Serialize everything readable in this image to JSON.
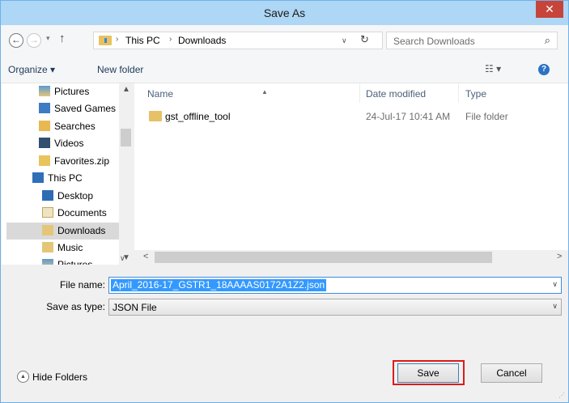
{
  "window": {
    "title": "Save As",
    "close_glyph": "✕",
    "accent_color": "#aed6f5",
    "close_color": "#c7443a"
  },
  "nav": {
    "back_glyph": "←",
    "forward_glyph": "→",
    "recent_glyph": "▾",
    "up_glyph": "↑",
    "breadcrumb": [
      "This PC",
      "Downloads"
    ],
    "breadcrumb_separator": "›",
    "address_dropdown_glyph": "∨",
    "refresh_glyph": "↻",
    "search_placeholder": "Search Downloads",
    "search_glyph": "⌕"
  },
  "toolbar": {
    "organize_label": "Organize ▾",
    "new_folder_label": "New folder",
    "view_glyph": "☷ ▾",
    "help_glyph": "?"
  },
  "tree": {
    "items": [
      {
        "label": "Pictures",
        "icon": "pictures-folder-icon",
        "selected": false
      },
      {
        "label": "Saved Games",
        "icon": "saved-games-icon",
        "selected": false
      },
      {
        "label": "Searches",
        "icon": "searches-icon",
        "selected": false
      },
      {
        "label": "Videos",
        "icon": "videos-icon",
        "selected": false
      },
      {
        "label": "Favorites.zip",
        "icon": "zip-icon",
        "selected": false
      },
      {
        "label": "This PC",
        "icon": "computer-icon",
        "selected": false
      },
      {
        "label": "Desktop",
        "icon": "desktop-icon",
        "selected": false
      },
      {
        "label": "Documents",
        "icon": "documents-icon",
        "selected": false
      },
      {
        "label": "Downloads",
        "icon": "downloads-icon",
        "selected": true
      },
      {
        "label": "Music",
        "icon": "music-icon",
        "selected": false
      },
      {
        "label": "Pictures",
        "icon": "pictures-folder-icon",
        "selected": false
      }
    ],
    "scroll_up_glyph": "▲",
    "scroll_down_glyph": "▼",
    "collapse_glyph": "∨"
  },
  "files": {
    "columns": {
      "name": "Name",
      "date_modified": "Date modified",
      "type": "Type",
      "sort_glyph": "▲"
    },
    "rows": [
      {
        "name": "gst_offline_tool",
        "date_modified": "24-Jul-17 10:41 AM",
        "type": "File folder",
        "icon": "folder-icon"
      }
    ],
    "hscroll_left_glyph": "<",
    "hscroll_right_glyph": ">"
  },
  "form": {
    "file_name_label": "File name:",
    "file_name_value": "April_2016-17_GSTR1_18AAAAS0172A1Z2.json",
    "save_as_type_label": "Save as type:",
    "save_as_type_value": "JSON File",
    "dropdown_glyph": "∨"
  },
  "footer": {
    "hide_folders_label": "Hide Folders",
    "hide_folders_glyph": "▲",
    "save_label": "Save",
    "cancel_label": "Cancel",
    "highlight_color": "#e01919",
    "grip_glyph": "⋰"
  }
}
